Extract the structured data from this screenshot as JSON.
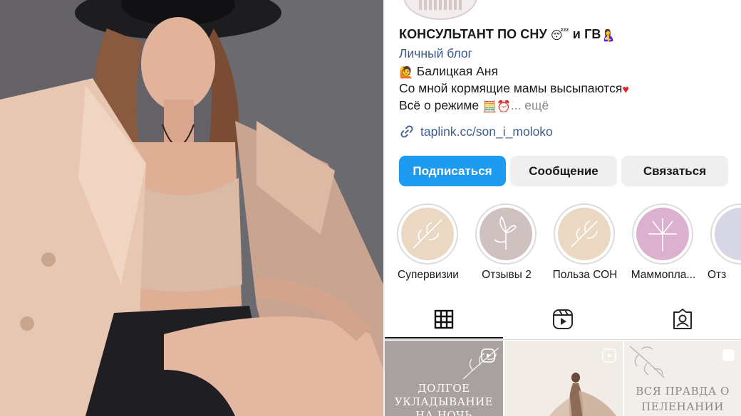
{
  "profile": {
    "name": "КОНСУЛЬТАНТ ПО СНУ",
    "name_suffix": "и ГВ",
    "category": "Личный блог",
    "bio": {
      "author": "Балицкая Аня",
      "line2": "Со мной кормящие мамы высыпаются",
      "line3": "Всё о режиме",
      "more": "... ещё"
    },
    "link": "taplink.cc/son_i_moloko",
    "icons": {
      "name_emoji_1": "sleeping-face-icon",
      "name_emoji_2": "breastfeeding-icon",
      "bio_emoji_1": "person-raising-hand-icon",
      "bio_emoji_2": "red-heart-icon",
      "bio_emoji_3": "abacus-icon",
      "bio_emoji_4": "alarm-clock-icon",
      "link_icon": "link-icon"
    }
  },
  "buttons": {
    "follow": "Подписаться",
    "message": "Сообщение",
    "contact": "Связаться"
  },
  "highlights": [
    {
      "label": "Супервизии",
      "color": "#ead8c3"
    },
    {
      "label": "Отзывы 2",
      "color": "#cfc1bf"
    },
    {
      "label": "Польза СОН",
      "color": "#ead8c3"
    },
    {
      "label": "Маммопла...",
      "color": "#dcb1cf"
    },
    {
      "label": "Отз",
      "color": "#d6d6e6"
    }
  ],
  "tabs": {
    "grid": "grid-icon",
    "reels": "reels-icon",
    "tagged": "tagged-icon",
    "active": "grid"
  },
  "posts": [
    {
      "caption_1": "ДОЛГОЕ",
      "caption_2": "УКЛАДЫВАНИЕ",
      "caption_3": "НА НОЧЬ",
      "bg": "#a8a1a0"
    },
    {
      "caption_1": "",
      "caption_2": "",
      "caption_3": "",
      "bg": "#efe9e4"
    },
    {
      "caption_1": "ВСЯ ПРАВДА О",
      "caption_2": "ПЕЛЕНАНИИ",
      "caption_3": "",
      "bg": "#f1eeeb"
    }
  ],
  "colors": {
    "accent": "#1d9bf0",
    "link": "#3f5e8c",
    "category": "#3b5a87"
  }
}
